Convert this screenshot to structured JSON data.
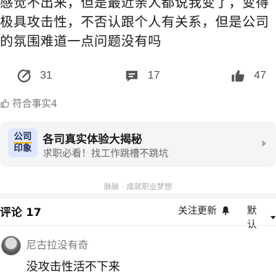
{
  "post": {
    "text": "感觉不出来，但是最近亲人都说我变了，变得极具攻击性，不否认跟个人有关系，但是公司的氛围难道一点问题没有吗"
  },
  "actions": {
    "share_count": "31",
    "comment_count": "17",
    "like_count": "47"
  },
  "fact_check": {
    "label": "符合事实4"
  },
  "promo": {
    "logo_line1": "公司",
    "logo_line2": "印象",
    "title": "各司真实体验大揭秘",
    "subtitle": "求职必看！找工作跳槽不跳坑"
  },
  "footer_note": "脉脉 · 成就职业梦想",
  "comments": {
    "title": "评论 17",
    "follow_label": "关注更新",
    "sort_label": "默认",
    "items": [
      {
        "user": "尼古拉没有奇",
        "text": "没攻击性活不下来"
      }
    ]
  },
  "colors": {
    "accent": "#f2b300",
    "promo_bg": "#f4f5f7",
    "muted_text": "#777777"
  },
  "icons": {
    "share": "share-arrow-icon",
    "comment": "comment-bubble-icon",
    "like": "thumbs-up-icon",
    "fact": "thumbs-up-outline-icon",
    "bell": "bell-icon",
    "sort": "caret-down-icon",
    "promo_arrow": "caret-right-icon"
  }
}
